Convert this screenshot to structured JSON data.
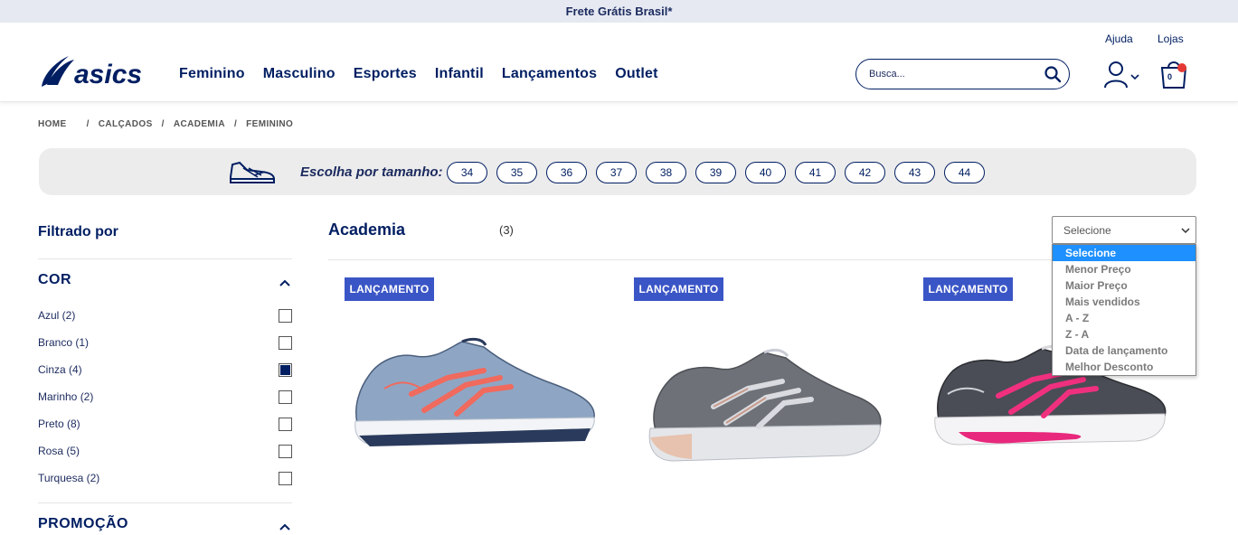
{
  "topbar": {
    "text": "Frete Grátis Brasil*"
  },
  "header": {
    "logo_text": "asics",
    "nav": [
      "Feminino",
      "Masculino",
      "Esportes",
      "Infantil",
      "Lançamentos",
      "Outlet"
    ],
    "util": {
      "help": "Ajuda",
      "stores": "Lojas"
    },
    "search": {
      "placeholder": "Busca..."
    },
    "cart": {
      "count": "0"
    }
  },
  "breadcrumb": [
    "HOME",
    "CALÇADOS",
    "ACADEMIA",
    "FEMININO"
  ],
  "sizebar": {
    "label": "Escolha por tamanho:",
    "sizes": [
      "34",
      "35",
      "36",
      "37",
      "38",
      "39",
      "40",
      "41",
      "42",
      "43",
      "44"
    ]
  },
  "filters": {
    "title": "Filtrado por",
    "color_facet": {
      "title": "COR",
      "options": [
        {
          "label": "Azul (2)",
          "checked": false
        },
        {
          "label": "Branco (1)",
          "checked": false
        },
        {
          "label": "Cinza (4)",
          "checked": true
        },
        {
          "label": "Marinho (2)",
          "checked": false
        },
        {
          "label": "Preto (8)",
          "checked": false
        },
        {
          "label": "Rosa (5)",
          "checked": false
        },
        {
          "label": "Turquesa (2)",
          "checked": false
        }
      ]
    },
    "promo_facet": {
      "title": "PROMOÇÃO"
    }
  },
  "category": {
    "title": "Academia",
    "count": "(3)"
  },
  "sort": {
    "selected": "Selecione",
    "options": [
      "Selecione",
      "Menor Preço",
      "Maior Preço",
      "Mais vendidos",
      "A - Z",
      "Z - A",
      "Data de lançamento",
      "Melhor Desconto"
    ]
  },
  "products": [
    {
      "badge": "LANÇAMENTO",
      "colorway": "blue-gray-coral"
    },
    {
      "badge": "LANÇAMENTO",
      "colorway": "gray-silver-rose"
    },
    {
      "badge": "LANÇAMENTO",
      "colorway": "gray-pink"
    }
  ],
  "colors": {
    "brand_navy": "#001e62",
    "badge_blue": "#3a55c6",
    "topbar_bg": "#e6e9f2",
    "select_highlight": "#1e90ff",
    "cart_dot": "#e53935"
  }
}
